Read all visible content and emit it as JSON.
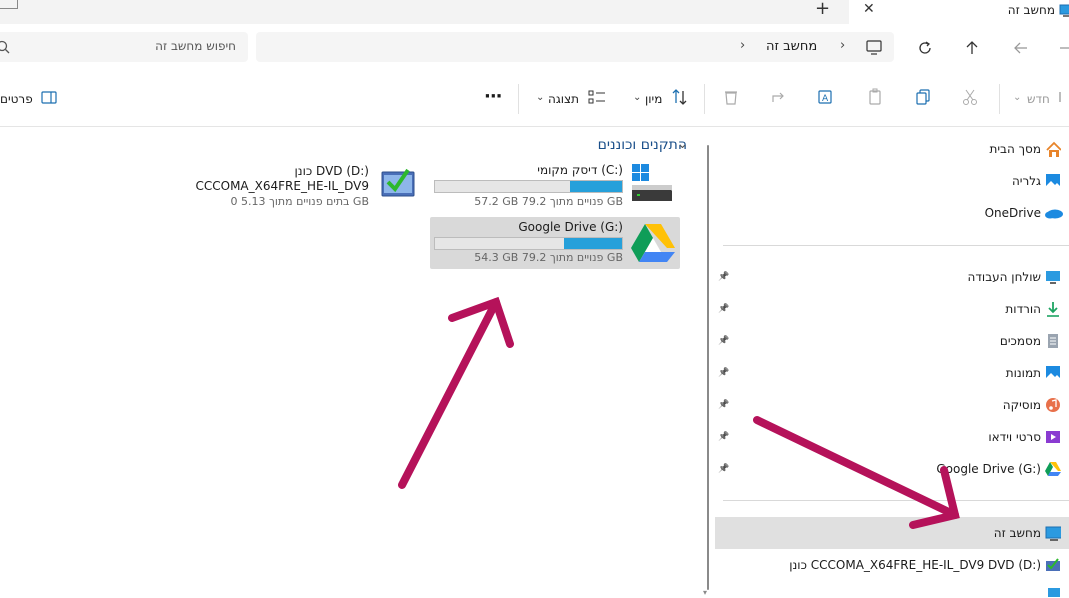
{
  "tab": {
    "title": "מחשב זה",
    "close": "✕",
    "add": "+"
  },
  "address": {
    "crumbs": [
      "מחשב זה"
    ],
    "search_placeholder": "חיפוש מחשב זה"
  },
  "toolbar": {
    "new_label": "חדש",
    "sort_label": "מיון",
    "view_label": "תצוגה",
    "more": "···",
    "details_label": "פרטים"
  },
  "section": {
    "title": "התקנים וכוננים"
  },
  "drives": [
    {
      "name": "דיסק מקומי (C:)",
      "free_text": "57.2 GB פנויים מתוך 79.2 GB",
      "fill_fraction": 0.28
    },
    {
      "name": "Google Drive (G:)",
      "free_text": "54.3 GB פנויים מתוך 79.2 GB",
      "fill_fraction": 0.31
    },
    {
      "line1": "כונן DVD (D:)",
      "line2": "CCCOMA_X64FRE_HE-IL_DV9",
      "free_text": "0 בתים פנויים מתוך 5.13 GB"
    }
  ],
  "nav": {
    "home": "מסך הבית",
    "gallery": "גלריה",
    "onedrive": "OneDrive",
    "pinned": [
      {
        "label": "שולחן העבודה",
        "icon": "desktop-icon"
      },
      {
        "label": "הורדות",
        "icon": "download-icon"
      },
      {
        "label": "מסמכים",
        "icon": "documents-icon"
      },
      {
        "label": "תמונות",
        "icon": "pictures-icon"
      },
      {
        "label": "מוסיקה",
        "icon": "music-icon"
      },
      {
        "label": "סרטי וידאו",
        "icon": "videos-icon"
      },
      {
        "label": "Google Drive (G:)",
        "icon": "google-drive-icon"
      }
    ],
    "this_pc": "מחשב זה",
    "dvd": "כונן CCCOMA_X64FRE_HE-IL_DV9 DVD (D:)"
  },
  "colors": {
    "annotation_arrow": "#b5125a",
    "accent": "#26a0da"
  }
}
